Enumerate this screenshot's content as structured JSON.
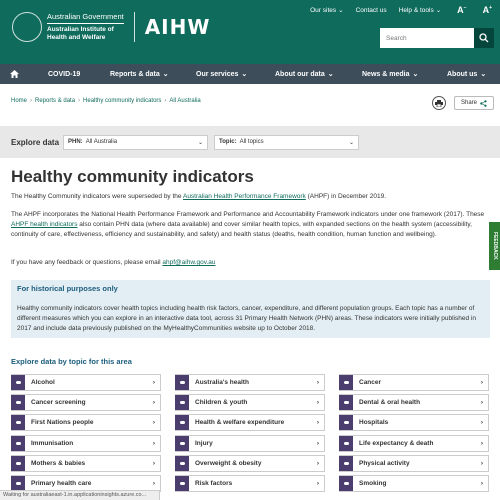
{
  "header": {
    "util_nav": [
      "Our sites",
      "Contact us",
      "Help & tools"
    ],
    "font_small": "A",
    "font_large": "A",
    "gov_line1": "Australian Government",
    "gov_line2": "Australian Institute of",
    "gov_line3": "Health and Welfare",
    "brand": "AIHW",
    "search_placeholder": "Search",
    "colors": {
      "primary": "#0f6b5c",
      "nav": "#3d4d5a"
    }
  },
  "nav": [
    "COVID-19",
    "Reports & data",
    "Our services",
    "About our data",
    "News & media",
    "About us"
  ],
  "breadcrumb": [
    "Home",
    "Reports & data",
    "Healthy community indicators",
    "All Australia"
  ],
  "tools": {
    "share": "Share"
  },
  "explore": {
    "label": "Explore data",
    "phn_label": "PHN:",
    "phn_value": "All Australia",
    "topic_label": "Topic:",
    "topic_value": "All topics"
  },
  "title": "Healthy community indicators",
  "p1": {
    "pre": "The Healthy Community indicators were superseded by the ",
    "link": "Australian Health Performance Framework",
    "post": " (AHPF) in December 2019."
  },
  "p2": {
    "pre": "The AHPF incorporates the National Health Performance Framework and Performance and Accountability Framework indicators under one framework (2017). These ",
    "link": "AHPF health indicators",
    "post": " also contain PHN data (where data available) and cover similar health topics, with expanded sections on the health system (accessibility, continuity of care, effectiveness, efficiency and sustainability, and safety) and health status (deaths, health condition, human function and wellbeing)."
  },
  "p3": {
    "pre": "If you have any feedback or questions, please email ",
    "link": "ahpf@aihw.gov.au"
  },
  "historical": {
    "title": "For historical purposes only",
    "body": "Healthy community indicators cover health topics including health risk factors, cancer, expenditure, and different population groups. Each topic has a number of different measures which you can explore in an interactive data tool, across 31 Primary Health Network (PHN) areas. These indicators were initially published in 2017 and include data previously published on the MyHealthyCommunities website up to October 2018."
  },
  "section_title": "Explore data by topic for this area",
  "topics": [
    "Alcohol",
    "Australia's health",
    "Cancer",
    "Cancer screening",
    "Children & youth",
    "Dental & oral health",
    "First Nations people",
    "Health & welfare expenditure",
    "Hospitals",
    "Immunisation",
    "Injury",
    "Life expectancy & death",
    "Mothers & babies",
    "Overweight & obesity",
    "Physical activity",
    "Primary health care",
    "Risk factors",
    "Smoking"
  ],
  "feedback": "FEEDBACK",
  "status": "Waiting for australiaeast-1.in.applicationinsights.azure.co..."
}
